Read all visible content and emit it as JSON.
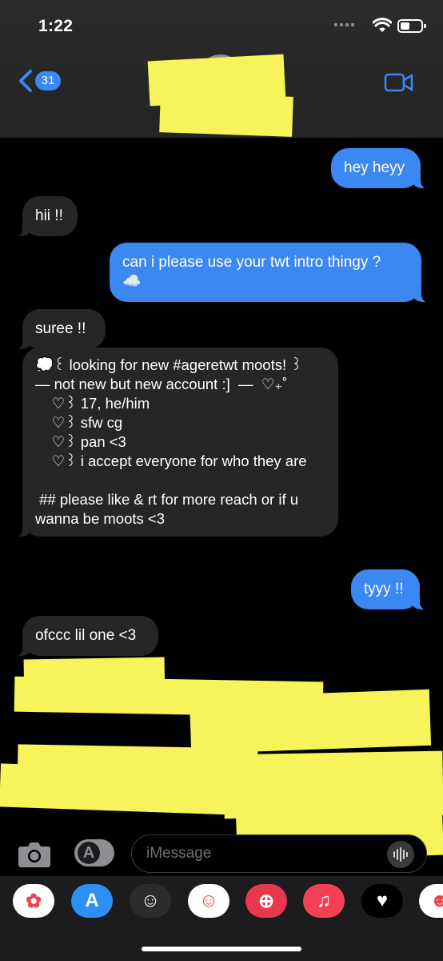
{
  "status_bar": {
    "time": "1:22"
  },
  "header": {
    "back_count": "31"
  },
  "messages": [
    {
      "from": "me",
      "text": "hey heyy"
    },
    {
      "from": "them",
      "text": "hii !!"
    },
    {
      "from": "me",
      "text": "can i please use your twt intro thingy ?\n☁️"
    },
    {
      "from": "them",
      "text": "suree !!"
    },
    {
      "from": "them",
      "text": "💭꒰ looking for new #ageretwt moots! ꒱\n— not new but new account :]  —  ♡₊˚\n    ♡꒱ 17, he/him\n    ♡꒱ sfw cg\n    ♡꒱ pan <3\n    ♡꒱ i accept everyone for who they are\n\n ## please like & rt for more reach or if u wanna be moots <3"
    },
    {
      "from": "me",
      "text": "tyyy !!"
    },
    {
      "from": "them",
      "text": "ofccc lil one <3"
    }
  ],
  "compose": {
    "placeholder": "iMessage"
  },
  "apps": [
    {
      "name": "photos-app-icon",
      "glyph": "✿",
      "color": "#ffffff"
    },
    {
      "name": "app-store-app-icon",
      "glyph": "A",
      "color": "#2d8ff4"
    },
    {
      "name": "memoji-app-icon",
      "glyph": "☺",
      "color": "#2c2c2e"
    },
    {
      "name": "animoji-stickers-app-icon",
      "glyph": "☺",
      "color": "#ffffff"
    },
    {
      "name": "web-search-app-icon",
      "glyph": "⊕",
      "color": "#e8384f"
    },
    {
      "name": "music-app-icon",
      "glyph": "♫",
      "color": "#f34055"
    },
    {
      "name": "digital-touch-app-icon",
      "glyph": "♥",
      "color": "#000000"
    },
    {
      "name": "game-app-icon",
      "glyph": "☻",
      "color": "#ffffff"
    }
  ]
}
